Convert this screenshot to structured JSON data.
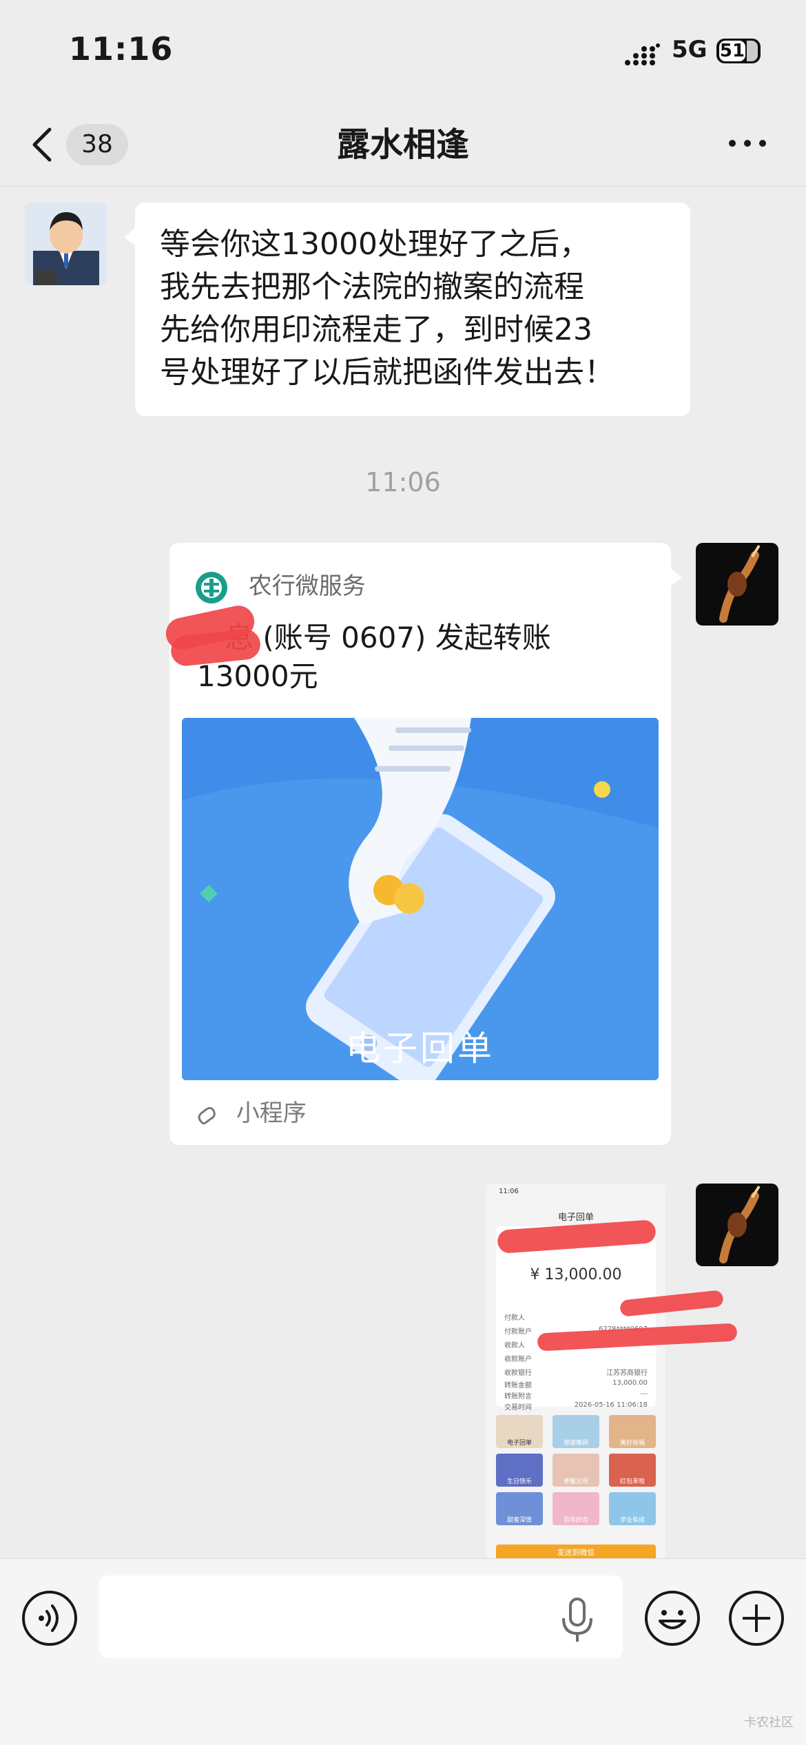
{
  "status_bar": {
    "time": "11:16",
    "network": "5G",
    "battery": "51"
  },
  "navbar": {
    "unread_count": "38",
    "title": "露水相逢"
  },
  "messages": {
    "incoming_text": "等会你这13000处理好了之后，\n我先去把那个法院的撤案的流程\n先给你用印流程走了，到时候23\n号处理好了以后就把函件发出去！",
    "timestamp": "11:06",
    "bank_card": {
      "source": "农行微服务",
      "title": "   息 (账号 0607) 发起转账\n13000元",
      "image_caption": "电子回单",
      "footer": "小程序"
    },
    "receipt": {
      "time": "11:06",
      "title": "电子回单",
      "amount": "¥ 13,000.00",
      "rows": [
        {
          "label": "付款人",
          "value": ""
        },
        {
          "label": "付款账户",
          "value": "6228****0607"
        },
        {
          "label": "收款人",
          "value": ""
        },
        {
          "label": "收款账户",
          "value": ""
        },
        {
          "label": "收款银行",
          "value": "江苏苏商银行"
        },
        {
          "label": "转账金额",
          "value": "13,000.00"
        },
        {
          "label": "转账附言",
          "value": "---"
        },
        {
          "label": "交易时间",
          "value": "2026-05-16 11:06:18"
        }
      ],
      "tiles": [
        "电子回单",
        "谢谢惠顾",
        "美好祝福",
        "生日快乐",
        "孝敬父母",
        "红包来啦",
        "甜蜜深情",
        "百年好合",
        "学业有成"
      ],
      "button": "发送到微信"
    }
  },
  "input": {
    "placeholder": ""
  },
  "watermark": "卡农社区",
  "colors": {
    "background": "#ededed",
    "bubble": "#ffffff",
    "card_banner": "#3f8de8",
    "redaction": "#f0474a"
  }
}
